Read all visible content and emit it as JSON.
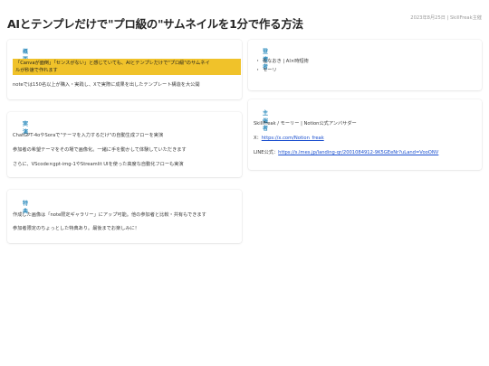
{
  "header": {
    "title": "AIとテンプレだけで\"プロ級の\"サムネイルを1分で作る方法",
    "meta": "2023年8月25日 | SkillFreak主催"
  },
  "overview": {
    "heading": "概要",
    "highlight_line1": "「Canvaが面倒」「センスがない」と感じていても、AIとテンプレだけで\"プロ級\"のサムネイ",
    "highlight_line2": "ルが秒速で作れます",
    "note": "noteでは150名以上が購入・実践し、Xで実際に成果を出したテンプレート構造を大公開"
  },
  "content": {
    "heading": "実演",
    "items": [
      "ChatGPT-4oやSoraで\"テーマを入力するだけ\"の自動生成フローを実演",
      "参加者の希望テーマをその場で画像化。一緒に手を動かして体験していただきます",
      "さらに、VScode×gpt-img-1やStreamlit UIを使った高度な自動化フローも実演"
    ]
  },
  "benefit": {
    "heading": "特典",
    "items": [
      "作成した画像は「note限定ギャラリー」にアップ可能。他の参加者と比較・共有もできます",
      "参加者限定のちょっとした特典あり。最後までお楽しみに！"
    ]
  },
  "speaker": {
    "heading": "登壇者",
    "items": [
      "佐なおき | AI×時短術",
      "モーリ"
    ]
  },
  "host": {
    "heading": "主催者",
    "name_line": "SkillFreak / モーリー | Notion公式アンバサダー",
    "x_label": "X：",
    "x_link": "https://x.com/Notion_freak",
    "line_label": "LINE公式：",
    "line_link": "https://s.lmes.jp/landing-qr/2001084912-9K5GEeNr?uLand=VooONV"
  },
  "colors": {
    "heading_accent": "#2c8bbd",
    "highlight": "#f0c22a",
    "link": "#1a4fcf"
  }
}
